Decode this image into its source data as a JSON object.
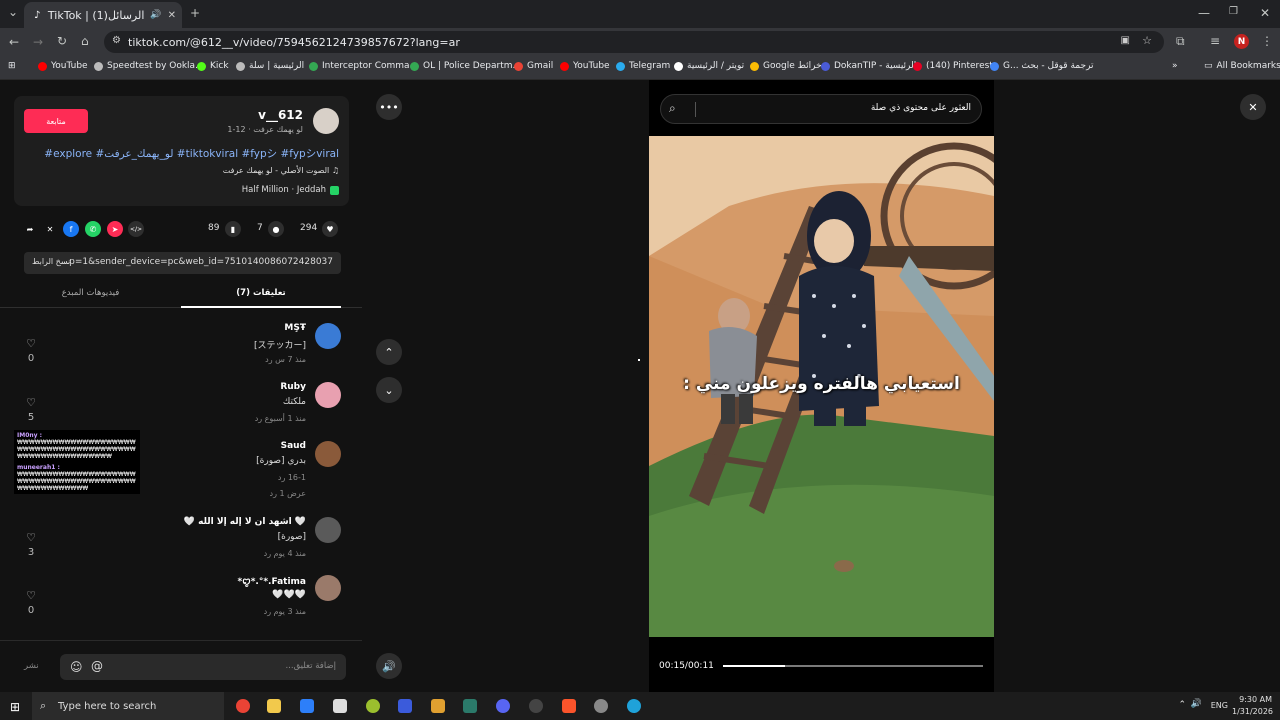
{
  "browser": {
    "tab_title": "TikTok | (1)الرسائل",
    "url": "tiktok.com/@612__v/video/7594562124739857672?lang=ar",
    "bookmarks": [
      {
        "label": "YouTube",
        "color": "#ff0000"
      },
      {
        "label": "Speedtest by Ookla...",
        "color": "#bbbbbb"
      },
      {
        "label": "Kick",
        "color": "#53fc18"
      },
      {
        "label": "الرئيسية | سلة",
        "color": "#bbbbbb"
      },
      {
        "label": "Interceptor Comma...",
        "color": "#34a853"
      },
      {
        "label": "OL | Police Departm...",
        "color": "#34a853"
      },
      {
        "label": "Gmail",
        "color": "#ea4335"
      },
      {
        "label": "YouTube",
        "color": "#ff0000"
      },
      {
        "label": "Telegram",
        "color": "#2aabee"
      },
      {
        "label": "تويتر / الرئيسية",
        "color": "#ffffff"
      },
      {
        "label": "Google خرائط",
        "color": "#fbbc04"
      },
      {
        "label": "DokanTIP - الرئيسية",
        "color": "#4a5bd6"
      },
      {
        "label": "(140) Pinterest",
        "color": "#e60023"
      },
      {
        "label": "G... ترجمة قوقل - بحث",
        "color": "#4285f4"
      }
    ],
    "all_bookmarks": "All Bookmarks"
  },
  "post": {
    "username": "v__612",
    "subline": "لو يهمك عرفت · 12-1",
    "follow_label": "متابعة",
    "hashtags": "#explore #لو_يهمك_عرفت #tiktokviral #fypシ #fypシviral",
    "sound": "الصوت الأصلي - لو يهمك عرفت",
    "location": "Half Million · Jeddah",
    "likes": "294",
    "comments": "7",
    "saves": "89",
    "link": "...p=1&sender_device=pc&web_id=7510140086072428037",
    "copy_link": "نسخ الرابط",
    "tab_comments": "(7) تعليقات",
    "tab_creator_videos": "فيديوهات المبدع"
  },
  "comments": [
    {
      "name": "MŞŦ",
      "text": "[ステッカー]",
      "meta": "منذ 7 س   رد",
      "likes": "0",
      "color": "#3a7bd5"
    },
    {
      "name": "Ruby",
      "text": "ملكتك",
      "meta": "منذ 1 أسبوع   رد",
      "likes": "5",
      "color": "#e8a0b0"
    },
    {
      "name": "Saud",
      "text": "بدري [صورة]",
      "meta": "16-1   رد",
      "extra": "عرض 1 رد",
      "likes": "",
      "color": "#8a5a3a"
    },
    {
      "name": "🤍 اشهد ان لا إله إلا الله 🤍",
      "text": "[صورة]",
      "meta": "منذ 4 يوم   رد",
      "likes": "3",
      "color": "#5a5a5a"
    },
    {
      "name": "ꨄ*.°*.Fatima*",
      "text": "🤍🤍🤍",
      "meta": "منذ 3 يوم   رد",
      "likes": "0",
      "color": "#9a7a6a"
    }
  ],
  "overlay_chat": [
    {
      "name": "IM0ny :",
      "text": "₩₩₩₩₩₩₩₩₩₩₩₩₩₩₩₩₩₩₩₩₩₩₩₩₩₩₩₩₩₩₩₩₩₩₩₩₩₩₩₩₩₩₩₩₩₩₩₩₩₩₩₩₩₩₩₩"
    },
    {
      "name": "muneerah1 :",
      "text": "₩₩₩₩₩₩₩₩₩₩₩₩₩₩₩₩₩₩₩₩₩₩₩₩₩₩₩₩₩₩₩₩₩₩₩₩₩₩₩₩₩₩₩₩₩₩₩₩₩₩₩₩"
    }
  ],
  "comment_bar": {
    "placeholder": "إضافة تعليق...",
    "post_label": "نشر"
  },
  "video": {
    "search_placeholder": "العثور على محتوى ذي صلة",
    "caption": "استعيابي هالفتره ويزعلون مني :",
    "time": "00:15/00:11",
    "progress": 0.24
  },
  "taskbar": {
    "search_placeholder": "Type here to search",
    "lang": "ENG",
    "time": "9:30 AM",
    "date": "1/31/2026"
  }
}
